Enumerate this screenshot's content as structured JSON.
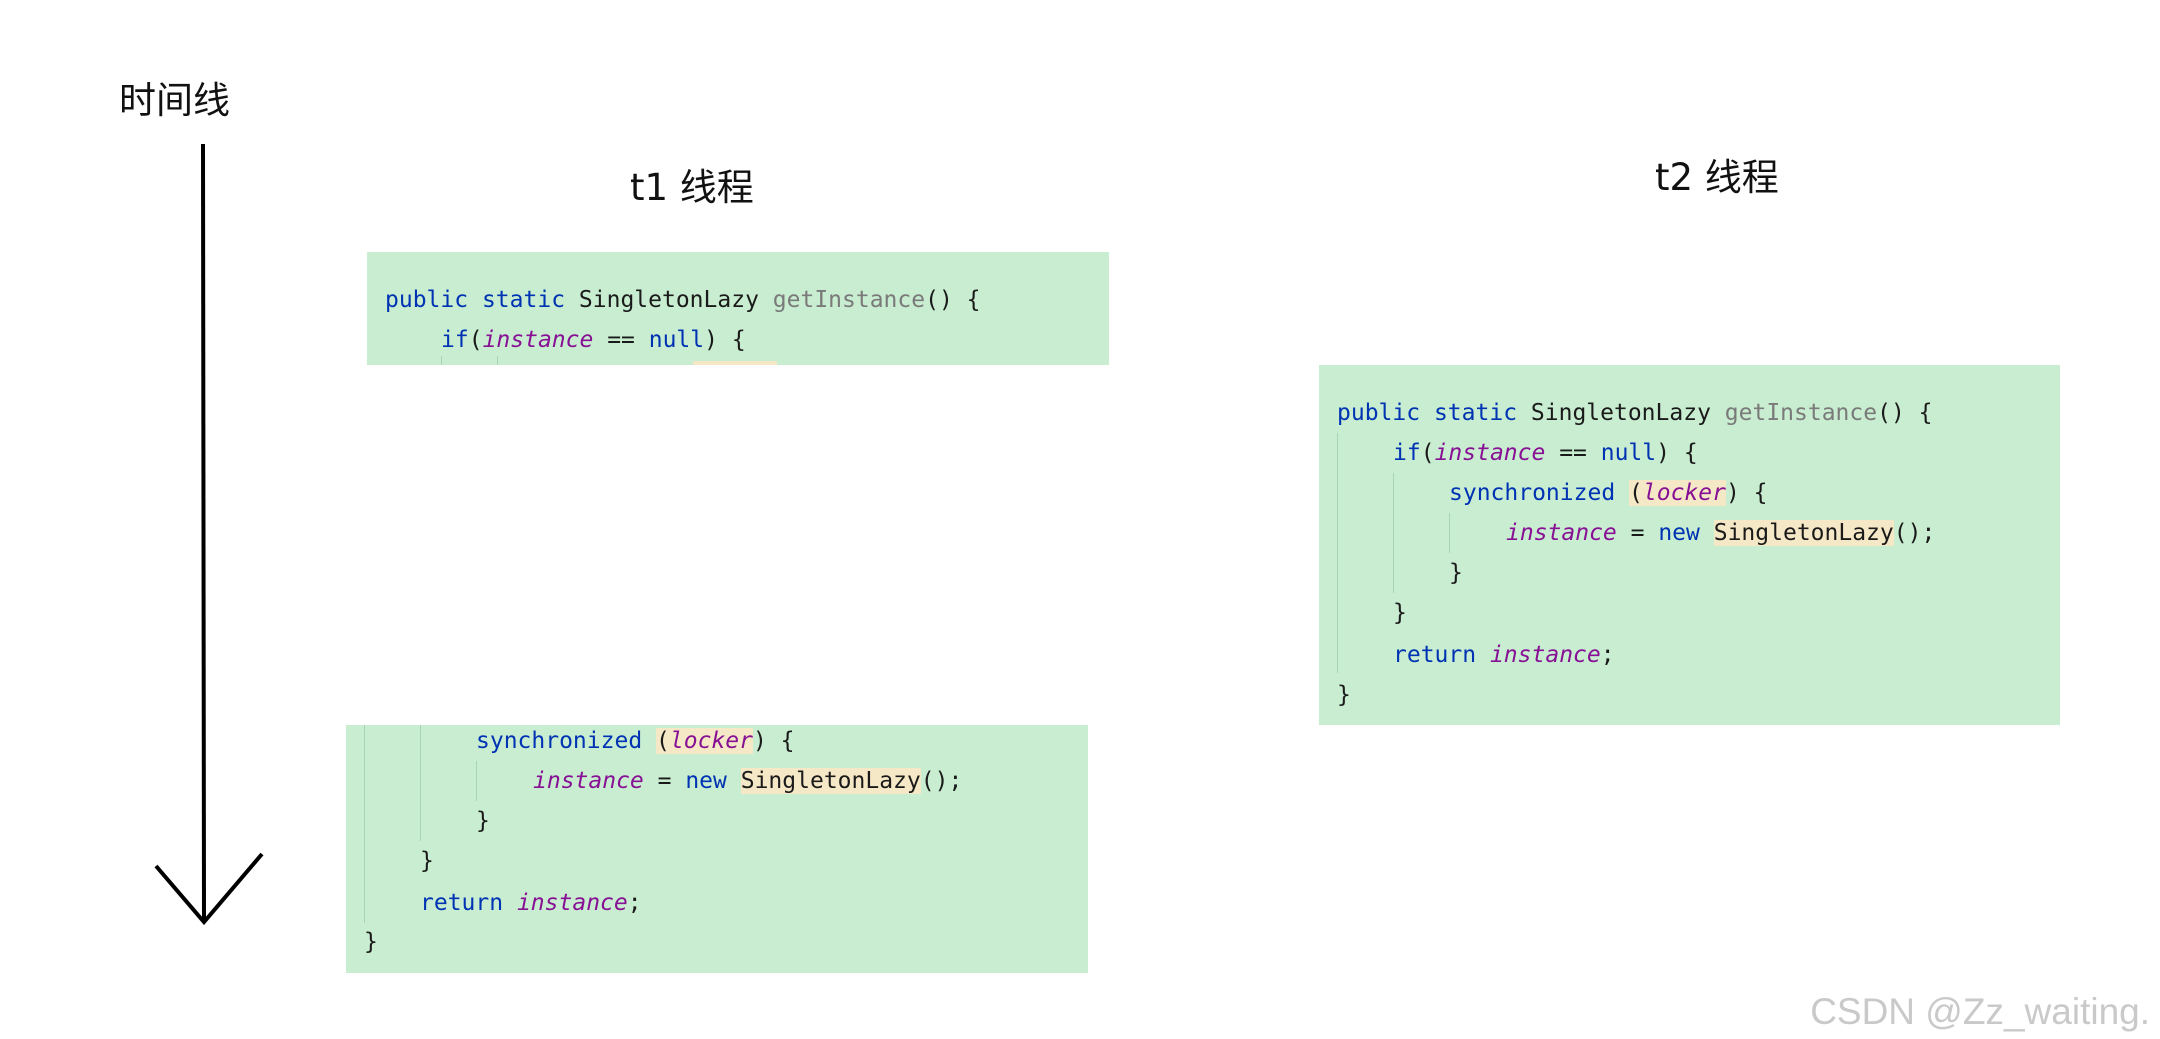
{
  "labels": {
    "timeline": "时间线",
    "t1": "t1 线程",
    "t2": "t2 线程",
    "watermark": "CSDN @Zz_waiting."
  },
  "code": {
    "public": "public",
    "static": "static",
    "class_name": "SingletonLazy",
    "method": "getInstance",
    "paren_open_brace": "() {",
    "if": "if",
    "paren_open": "(",
    "instance": "instance",
    "eq_null_part": " == ",
    "null": "null",
    "close_paren_brace": ") {",
    "synchronized": "synchronized",
    "locker": "locker",
    "assign": " = ",
    "new": "new",
    "ctor_call_end": "();",
    "close_brace": "}",
    "return": "return",
    "semicolon": ";"
  },
  "colors": {
    "code_background": "#c8edd0",
    "keyword": "#0033b3",
    "method": "#7a7a7a",
    "field": "#871094",
    "highlight": "#f5e8c6",
    "arrow": "#000000"
  }
}
